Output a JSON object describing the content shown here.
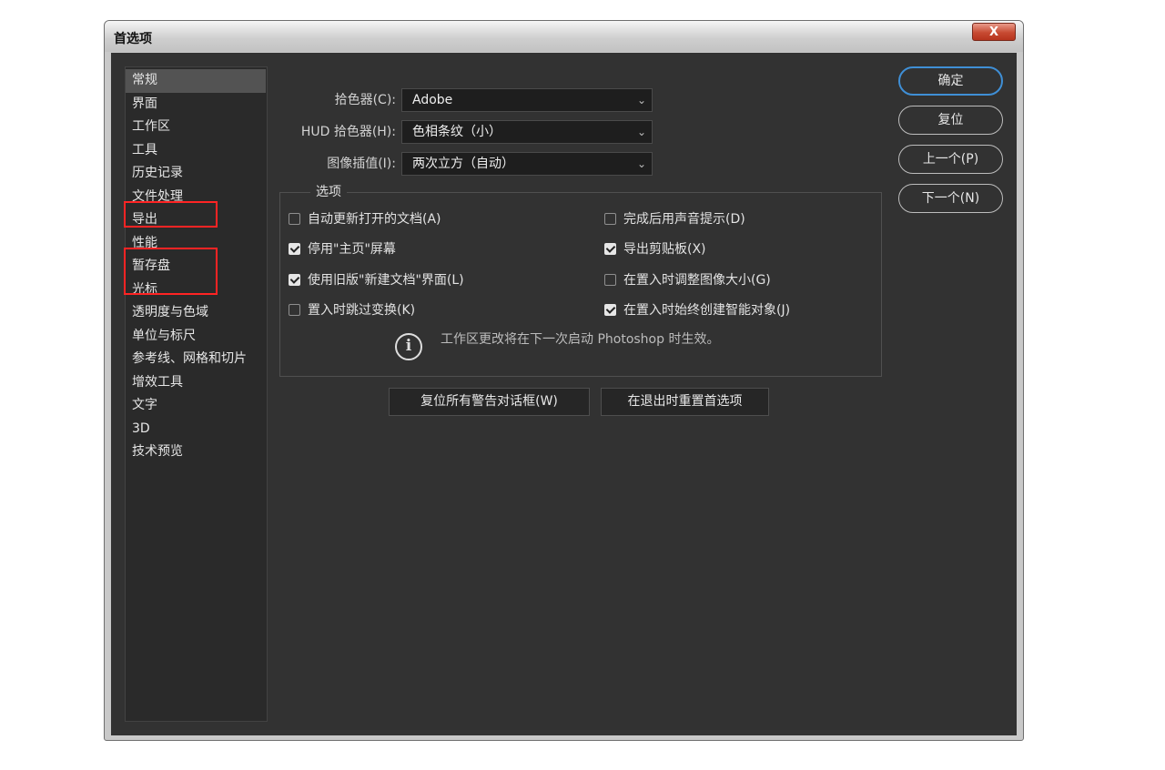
{
  "window": {
    "title": "首选项",
    "close_glyph": "X"
  },
  "sidebar": {
    "items": [
      {
        "label": "常规"
      },
      {
        "label": "界面"
      },
      {
        "label": "工作区"
      },
      {
        "label": "工具"
      },
      {
        "label": "历史记录"
      },
      {
        "label": "文件处理"
      },
      {
        "label": "导出"
      },
      {
        "label": "性能"
      },
      {
        "label": "暂存盘"
      },
      {
        "label": "光标"
      },
      {
        "label": "透明度与色域"
      },
      {
        "label": "单位与标尺"
      },
      {
        "label": "参考线、网格和切片"
      },
      {
        "label": "增效工具"
      },
      {
        "label": "文字"
      },
      {
        "label": "3D"
      },
      {
        "label": "技术预览"
      }
    ],
    "selected": "常规"
  },
  "fields": {
    "color_picker": {
      "label": "拾色器(C):",
      "value": "Adobe"
    },
    "hud_color_picker": {
      "label": "HUD 拾色器(H):",
      "value": "色相条纹（小）"
    },
    "image_interpolation": {
      "label": "图像插值(I):",
      "value": "两次立方（自动）"
    }
  },
  "options": {
    "legend": "选项",
    "left": [
      {
        "label": "自动更新打开的文档(A)",
        "checked": false
      },
      {
        "label": "停用\"主页\"屏幕",
        "checked": true
      },
      {
        "label": "使用旧版\"新建文档\"界面(L)",
        "checked": true
      },
      {
        "label": "置入时跳过变换(K)",
        "checked": false
      }
    ],
    "right": [
      {
        "label": "完成后用声音提示(D)",
        "checked": false
      },
      {
        "label": "导出剪贴板(X)",
        "checked": true
      },
      {
        "label": "在置入时调整图像大小(G)",
        "checked": false
      },
      {
        "label": "在置入时始终创建智能对象(J)",
        "checked": true
      }
    ],
    "info_glyph": "i",
    "note": "工作区更改将在下一次启动 Photoshop 时生效。"
  },
  "actions": {
    "reset_warnings": "复位所有警告对话框(W)",
    "reset_prefs": "在退出时重置首选项"
  },
  "buttons": {
    "ok": "确定",
    "reset": "复位",
    "prev": "上一个(P)",
    "next": "下一个(N)"
  },
  "colors": {
    "highlight": "#ff2424",
    "primary_ring": "#3f8fd6",
    "panel": "#323232"
  }
}
